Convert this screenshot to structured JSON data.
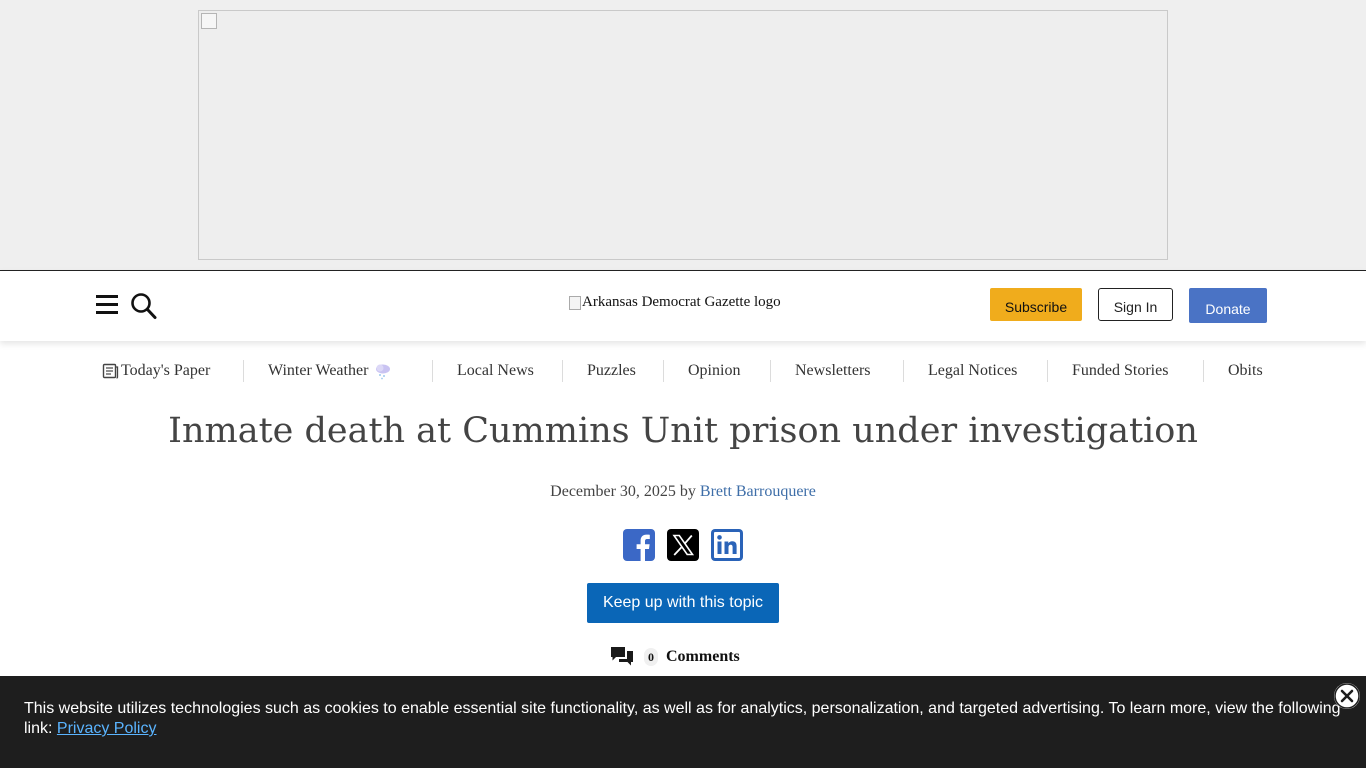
{
  "header": {
    "logo_alt": "Arkansas Democrat Gazette logo",
    "subscribe_label": "Subscribe",
    "signin_label": "Sign In",
    "donate_label": "Donate"
  },
  "nav": {
    "items": [
      {
        "label": "Today's Paper",
        "icon": "newspaper-icon"
      },
      {
        "label": "Winter Weather",
        "icon": "snow-cloud-icon"
      },
      {
        "label": "Local News"
      },
      {
        "label": "Puzzles"
      },
      {
        "label": "Opinion"
      },
      {
        "label": "Newsletters"
      },
      {
        "label": "Legal Notices"
      },
      {
        "label": "Funded Stories"
      },
      {
        "label": "Obits"
      }
    ]
  },
  "article": {
    "headline": "Inmate death at Cummins Unit prison under investigation",
    "date": "December 30, 2025",
    "by_word": "by",
    "author": "Brett Barrouquere",
    "keep_up_label": "Keep up with this topic",
    "comment_count": "0",
    "comments_label": "Comments"
  },
  "share": {
    "icons": [
      "facebook-icon",
      "x-icon",
      "linkedin-icon"
    ],
    "facebook_color": "#3b68c6",
    "x_color": "#000000",
    "linkedin_color": "#2a63b8"
  },
  "cookie_banner": {
    "text": "This website utilizes technologies such as cookies to enable essential site functionality, as well as for analytics, personalization, and targeted advertising. To learn more, view the following link:",
    "link_label": "Privacy Policy"
  },
  "colors": {
    "subscribe": "#f0ac1c",
    "donate": "#4a73c5",
    "keep_up": "#0a66b7",
    "banner": "#1e1e1e",
    "author_link": "#3e6ea8"
  }
}
